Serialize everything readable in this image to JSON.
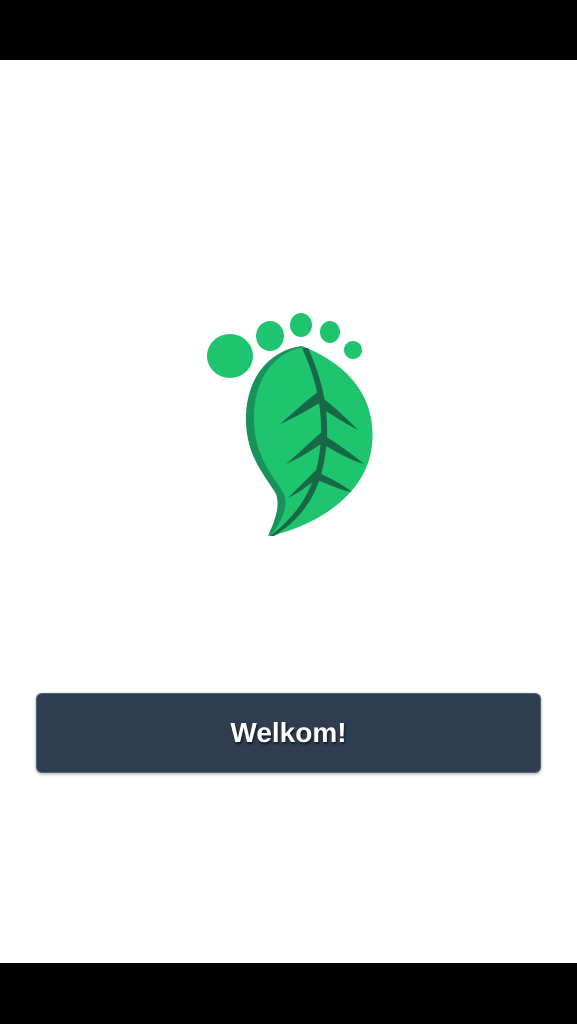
{
  "app": {
    "logo_icon": "leaf-footprint-icon",
    "logo_colors": {
      "leaf": "#1fc46e",
      "leaf_shadow": "#17935a",
      "vein": "#166846"
    }
  },
  "welcome_button": {
    "label": "Welkom!",
    "background": "#2e3e50"
  }
}
